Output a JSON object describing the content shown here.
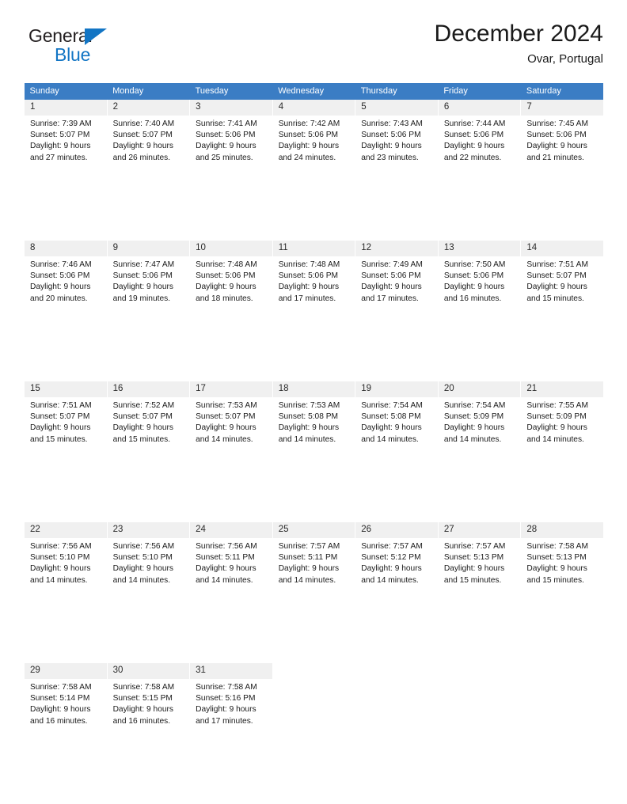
{
  "brand": {
    "name_dark": "General",
    "name_blue": "Blue",
    "accent_color": "#1275c4"
  },
  "header": {
    "month_title": "December 2024",
    "location": "Ovar, Portugal",
    "header_bg_color": "#3b7dc4",
    "daynum_bg_color": "#f0f0f0"
  },
  "weekday_headers": [
    "Sunday",
    "Monday",
    "Tuesday",
    "Wednesday",
    "Thursday",
    "Friday",
    "Saturday"
  ],
  "weeks": [
    [
      {
        "day": "1",
        "sunrise": "Sunrise: 7:39 AM",
        "sunset": "Sunset: 5:07 PM",
        "daylight1": "Daylight: 9 hours",
        "daylight2": "and 27 minutes."
      },
      {
        "day": "2",
        "sunrise": "Sunrise: 7:40 AM",
        "sunset": "Sunset: 5:07 PM",
        "daylight1": "Daylight: 9 hours",
        "daylight2": "and 26 minutes."
      },
      {
        "day": "3",
        "sunrise": "Sunrise: 7:41 AM",
        "sunset": "Sunset: 5:06 PM",
        "daylight1": "Daylight: 9 hours",
        "daylight2": "and 25 minutes."
      },
      {
        "day": "4",
        "sunrise": "Sunrise: 7:42 AM",
        "sunset": "Sunset: 5:06 PM",
        "daylight1": "Daylight: 9 hours",
        "daylight2": "and 24 minutes."
      },
      {
        "day": "5",
        "sunrise": "Sunrise: 7:43 AM",
        "sunset": "Sunset: 5:06 PM",
        "daylight1": "Daylight: 9 hours",
        "daylight2": "and 23 minutes."
      },
      {
        "day": "6",
        "sunrise": "Sunrise: 7:44 AM",
        "sunset": "Sunset: 5:06 PM",
        "daylight1": "Daylight: 9 hours",
        "daylight2": "and 22 minutes."
      },
      {
        "day": "7",
        "sunrise": "Sunrise: 7:45 AM",
        "sunset": "Sunset: 5:06 PM",
        "daylight1": "Daylight: 9 hours",
        "daylight2": "and 21 minutes."
      }
    ],
    [
      {
        "day": "8",
        "sunrise": "Sunrise: 7:46 AM",
        "sunset": "Sunset: 5:06 PM",
        "daylight1": "Daylight: 9 hours",
        "daylight2": "and 20 minutes."
      },
      {
        "day": "9",
        "sunrise": "Sunrise: 7:47 AM",
        "sunset": "Sunset: 5:06 PM",
        "daylight1": "Daylight: 9 hours",
        "daylight2": "and 19 minutes."
      },
      {
        "day": "10",
        "sunrise": "Sunrise: 7:48 AM",
        "sunset": "Sunset: 5:06 PM",
        "daylight1": "Daylight: 9 hours",
        "daylight2": "and 18 minutes."
      },
      {
        "day": "11",
        "sunrise": "Sunrise: 7:48 AM",
        "sunset": "Sunset: 5:06 PM",
        "daylight1": "Daylight: 9 hours",
        "daylight2": "and 17 minutes."
      },
      {
        "day": "12",
        "sunrise": "Sunrise: 7:49 AM",
        "sunset": "Sunset: 5:06 PM",
        "daylight1": "Daylight: 9 hours",
        "daylight2": "and 17 minutes."
      },
      {
        "day": "13",
        "sunrise": "Sunrise: 7:50 AM",
        "sunset": "Sunset: 5:06 PM",
        "daylight1": "Daylight: 9 hours",
        "daylight2": "and 16 minutes."
      },
      {
        "day": "14",
        "sunrise": "Sunrise: 7:51 AM",
        "sunset": "Sunset: 5:07 PM",
        "daylight1": "Daylight: 9 hours",
        "daylight2": "and 15 minutes."
      }
    ],
    [
      {
        "day": "15",
        "sunrise": "Sunrise: 7:51 AM",
        "sunset": "Sunset: 5:07 PM",
        "daylight1": "Daylight: 9 hours",
        "daylight2": "and 15 minutes."
      },
      {
        "day": "16",
        "sunrise": "Sunrise: 7:52 AM",
        "sunset": "Sunset: 5:07 PM",
        "daylight1": "Daylight: 9 hours",
        "daylight2": "and 15 minutes."
      },
      {
        "day": "17",
        "sunrise": "Sunrise: 7:53 AM",
        "sunset": "Sunset: 5:07 PM",
        "daylight1": "Daylight: 9 hours",
        "daylight2": "and 14 minutes."
      },
      {
        "day": "18",
        "sunrise": "Sunrise: 7:53 AM",
        "sunset": "Sunset: 5:08 PM",
        "daylight1": "Daylight: 9 hours",
        "daylight2": "and 14 minutes."
      },
      {
        "day": "19",
        "sunrise": "Sunrise: 7:54 AM",
        "sunset": "Sunset: 5:08 PM",
        "daylight1": "Daylight: 9 hours",
        "daylight2": "and 14 minutes."
      },
      {
        "day": "20",
        "sunrise": "Sunrise: 7:54 AM",
        "sunset": "Sunset: 5:09 PM",
        "daylight1": "Daylight: 9 hours",
        "daylight2": "and 14 minutes."
      },
      {
        "day": "21",
        "sunrise": "Sunrise: 7:55 AM",
        "sunset": "Sunset: 5:09 PM",
        "daylight1": "Daylight: 9 hours",
        "daylight2": "and 14 minutes."
      }
    ],
    [
      {
        "day": "22",
        "sunrise": "Sunrise: 7:56 AM",
        "sunset": "Sunset: 5:10 PM",
        "daylight1": "Daylight: 9 hours",
        "daylight2": "and 14 minutes."
      },
      {
        "day": "23",
        "sunrise": "Sunrise: 7:56 AM",
        "sunset": "Sunset: 5:10 PM",
        "daylight1": "Daylight: 9 hours",
        "daylight2": "and 14 minutes."
      },
      {
        "day": "24",
        "sunrise": "Sunrise: 7:56 AM",
        "sunset": "Sunset: 5:11 PM",
        "daylight1": "Daylight: 9 hours",
        "daylight2": "and 14 minutes."
      },
      {
        "day": "25",
        "sunrise": "Sunrise: 7:57 AM",
        "sunset": "Sunset: 5:11 PM",
        "daylight1": "Daylight: 9 hours",
        "daylight2": "and 14 minutes."
      },
      {
        "day": "26",
        "sunrise": "Sunrise: 7:57 AM",
        "sunset": "Sunset: 5:12 PM",
        "daylight1": "Daylight: 9 hours",
        "daylight2": "and 14 minutes."
      },
      {
        "day": "27",
        "sunrise": "Sunrise: 7:57 AM",
        "sunset": "Sunset: 5:13 PM",
        "daylight1": "Daylight: 9 hours",
        "daylight2": "and 15 minutes."
      },
      {
        "day": "28",
        "sunrise": "Sunrise: 7:58 AM",
        "sunset": "Sunset: 5:13 PM",
        "daylight1": "Daylight: 9 hours",
        "daylight2": "and 15 minutes."
      }
    ],
    [
      {
        "day": "29",
        "sunrise": "Sunrise: 7:58 AM",
        "sunset": "Sunset: 5:14 PM",
        "daylight1": "Daylight: 9 hours",
        "daylight2": "and 16 minutes."
      },
      {
        "day": "30",
        "sunrise": "Sunrise: 7:58 AM",
        "sunset": "Sunset: 5:15 PM",
        "daylight1": "Daylight: 9 hours",
        "daylight2": "and 16 minutes."
      },
      {
        "day": "31",
        "sunrise": "Sunrise: 7:58 AM",
        "sunset": "Sunset: 5:16 PM",
        "daylight1": "Daylight: 9 hours",
        "daylight2": "and 17 minutes."
      },
      {
        "day": "",
        "sunrise": "",
        "sunset": "",
        "daylight1": "",
        "daylight2": ""
      },
      {
        "day": "",
        "sunrise": "",
        "sunset": "",
        "daylight1": "",
        "daylight2": ""
      },
      {
        "day": "",
        "sunrise": "",
        "sunset": "",
        "daylight1": "",
        "daylight2": ""
      },
      {
        "day": "",
        "sunrise": "",
        "sunset": "",
        "daylight1": "",
        "daylight2": ""
      }
    ]
  ]
}
